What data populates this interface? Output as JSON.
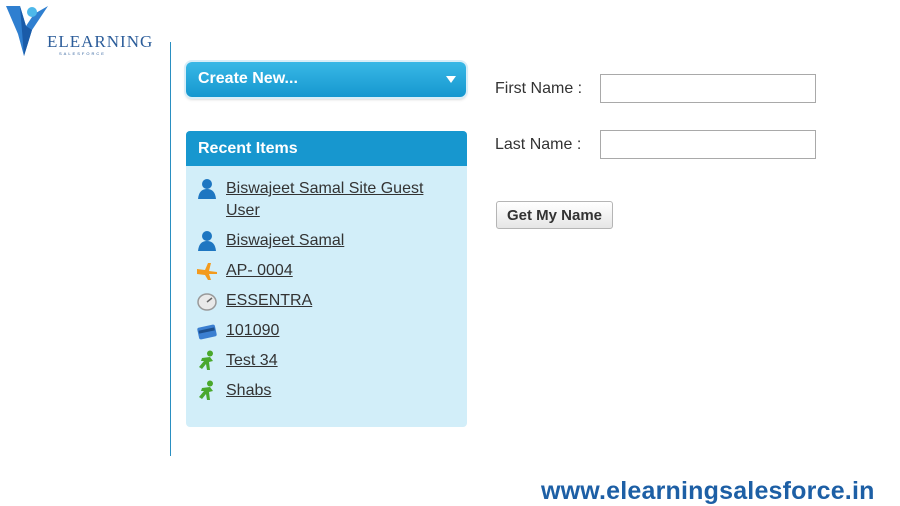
{
  "logo": {
    "name": "ELEARNING",
    "subtitle": "SALESFORCE"
  },
  "sidebar": {
    "create_new": {
      "label": "Create New..."
    },
    "recent_items": {
      "title": "Recent Items",
      "items": [
        {
          "label": "Biswajeet Samal Site Guest User",
          "icon": "user-icon"
        },
        {
          "label": "Biswajeet Samal",
          "icon": "user-icon"
        },
        {
          "label": "AP- 0004",
          "icon": "airplane-icon"
        },
        {
          "label": "ESSENTRA",
          "icon": "gauge-icon"
        },
        {
          "label": "101090",
          "icon": "card-icon"
        },
        {
          "label": "Test 34",
          "icon": "runner-icon"
        },
        {
          "label": "Shabs",
          "icon": "runner-icon"
        }
      ]
    }
  },
  "form": {
    "first_name_label": "First Name :",
    "first_name_value": "",
    "last_name_label": "Last Name :",
    "last_name_value": "",
    "submit_label": "Get My Name"
  },
  "footer": {
    "url": "www.elearningsalesforce.in"
  },
  "colors": {
    "accent": "#1797cf",
    "panel": "#d2eef9",
    "brand": "#1d5fa5"
  }
}
